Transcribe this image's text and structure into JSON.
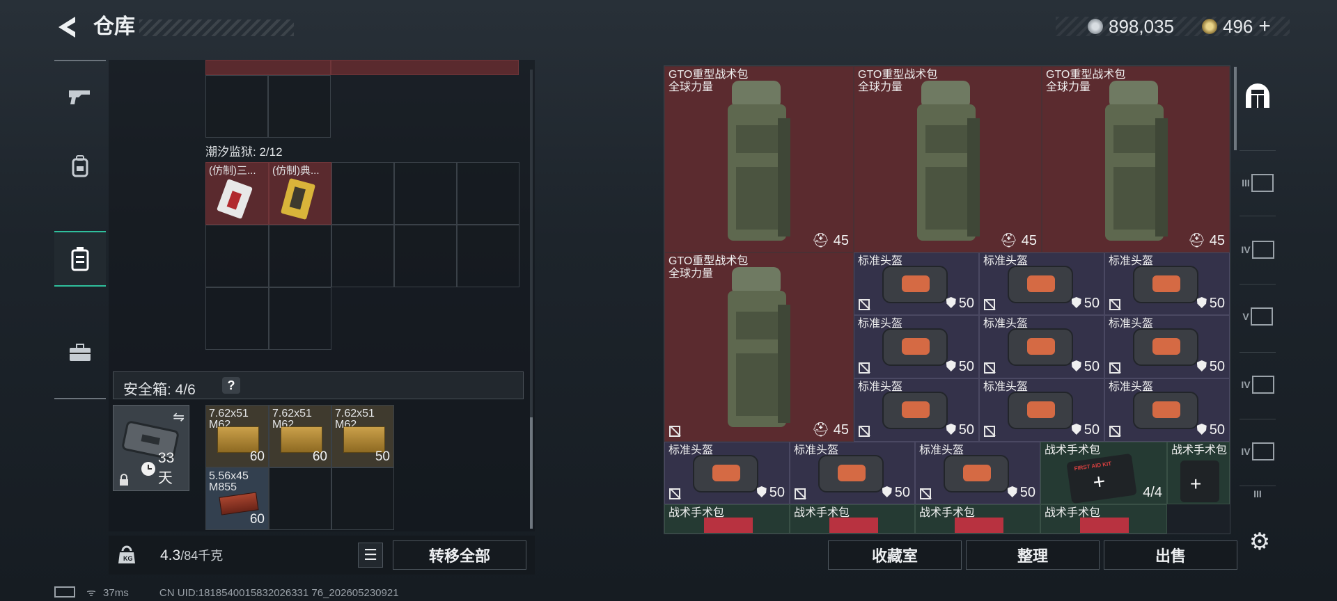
{
  "header": {
    "back_icon": "back-arrow-icon",
    "title": "仓库",
    "currency1": "898,035",
    "currency2": "496",
    "currency2_plus": "+"
  },
  "sidebar": {
    "tabs": [
      {
        "icon": "gun-icon"
      },
      {
        "icon": "backpack-icon"
      },
      {
        "icon": "container-icon",
        "active": true
      },
      {
        "icon": "briefcase-icon"
      }
    ]
  },
  "stash": {
    "prison_label": "潮汐监狱: 2/12",
    "prison_items": [
      "(仿制)三...",
      "(仿制)典..."
    ],
    "safebox_label": "安全箱: 4/6",
    "safebox_help": "?",
    "safebox_days": "33天",
    "ammo": [
      {
        "name": "7.62x51",
        "sub": "M62",
        "count": "60"
      },
      {
        "name": "7.62x51",
        "sub": "M62",
        "count": "60"
      },
      {
        "name": "7.62x51",
        "sub": "M62",
        "count": "50"
      },
      {
        "name": "5.56x45",
        "sub": "M855",
        "count": "60"
      }
    ],
    "weight_current": "4.3",
    "weight_max": "/84千克",
    "transfer_all": "转移全部"
  },
  "inventory": {
    "backpack_name1": "GTO重型战术包",
    "backpack_name2": "全球力量",
    "backpack_val": "45",
    "helmet_name": "标准头盔",
    "helmet_val": "50",
    "medkit_name": "战术手术包",
    "medkit_val": "4/4",
    "medkit_logo": "FIRST AID KIT"
  },
  "buttons": {
    "collection": "收藏室",
    "organize": "整理",
    "sell": "出售"
  },
  "right_strip": [
    "home-icon",
    "III",
    "IV",
    "V",
    "IV",
    "IV",
    "III"
  ],
  "status": {
    "ping": "37ms",
    "uid": "CN UID:1818540015832026331 76_202605230921"
  },
  "colors": {
    "accent": "#2fbf9c",
    "backpack_bg": "#5b2b2f",
    "helmet_bg": "#34324a",
    "medkit_bg": "#253a33"
  }
}
